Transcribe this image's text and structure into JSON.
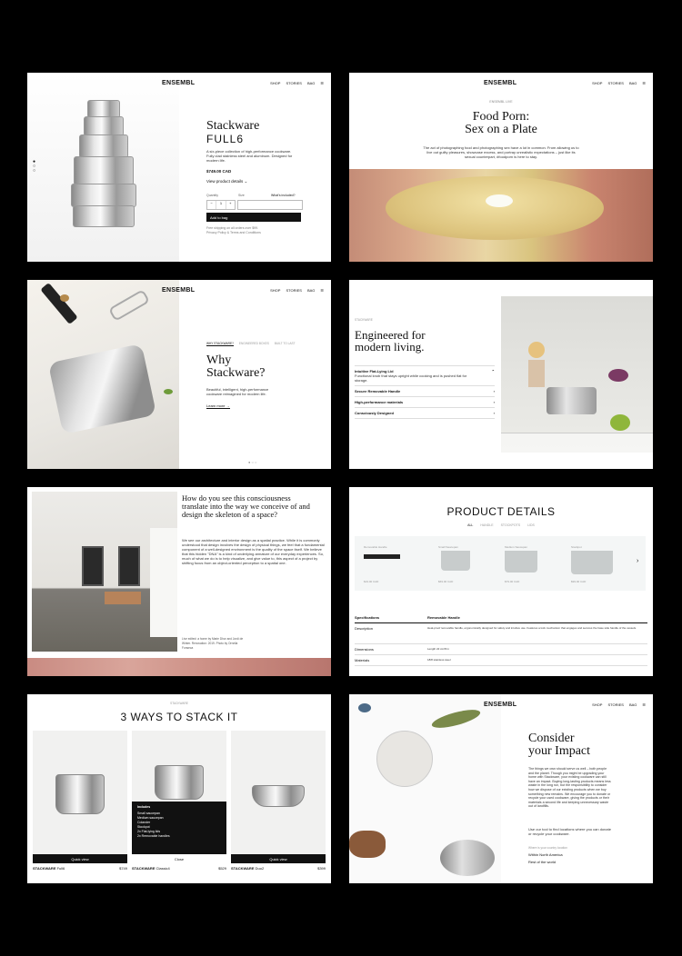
{
  "brand": "ENSEMBL",
  "nav": {
    "shop": "SHOP",
    "stories": "STORIES",
    "bag": "BAG",
    "menu": "☰"
  },
  "p1": {
    "title1": "Stackware",
    "title2": "FULL6",
    "desc": "A six-piece collection of high-performance cookware. Fully clad stainless steel and aluminum. Designed for modern life.",
    "price": "$749.00 CAD",
    "details": "View product details",
    "qty_label": "Quantity",
    "size_label": "Size",
    "size_hint": "What's included?",
    "add": "Add to bag",
    "note": "Free shipping on all orders over $99.\nPrivacy Policy & Terms and Conditions"
  },
  "p2": {
    "kicker": "ENSEMBL LIVE",
    "title1": "Food Porn:",
    "title2": "Sex on a Plate",
    "body": "The act of photographing food and photographing sex have a lot in common. From allowing us to live out guilty pleasures, showcase excess, and portray unrealistic expectations – just like its sexual counterpart, #foodporn is here to stay."
  },
  "p3": {
    "tabs": [
      "WHY STACKWARE?",
      "ENGINEERED BOXES",
      "BUILT TO LAST"
    ],
    "title1": "Why",
    "title2": "Stackware?",
    "body": "Beautiful, intelligent, high-performance cookware reimagined for modern life.",
    "learn": "Learn more"
  },
  "p4": {
    "kicker": "STACKWARE",
    "title1": "Engineered for",
    "title2": "modern living.",
    "items": [
      {
        "label": "Intuitive Flat-Lying Lid",
        "body": "Functional knob that stays upright while cooking and is pushed flat for storage."
      },
      {
        "label": "Secure Removable Handle",
        "body": ""
      },
      {
        "label": "High-performance materials",
        "body": ""
      },
      {
        "label": "Consciously Designed",
        "body": ""
      }
    ]
  },
  "p5": {
    "title": "How do you see this consciousness translate into the way we conceive of and design the skeleton of a space?",
    "body": "We see our architecture and interior design as a spatial practice. While it is commonly understood that design involves the design of physical things, we feel that a fundamental component of a well-designed environment is the quality of the space itself. We believe that this hidden \"DNA\" is a kind of underlying armature of our everyday experiences. So, much of what we do is to help visualize, and give value to, this aspect of a project by shifting focus from an object-oriented perception to a spatial one.",
    "caption": "Live edited: a home by Marie Dhor and Jordi de Winter. Renovation: 2019. Photo by Ornella Fonseca"
  },
  "p6": {
    "title": "PRODUCT DETAILS",
    "filters": [
      "ALL",
      "HANDLE",
      "STOCKPOTS",
      "LIDS"
    ],
    "items": [
      {
        "label": "Removable Handle",
        "meta": "$19.00 CAD"
      },
      {
        "label": "Small Saucepan",
        "meta": "$69.00 CAD"
      },
      {
        "label": "Medium Saucepan",
        "meta": "$79.00 CAD"
      },
      {
        "label": "Stockpot",
        "meta": "$99.00 CAD"
      }
    ],
    "spec_head": "Specifications",
    "spec_value": "Removable Handle",
    "specs": [
      {
        "k": "Description",
        "v": "Heat-proof removable handle, ergonomically designed for safety and intuitive use. Features a lock mechanism that engages and secures the base side handle of the vessels."
      },
      {
        "k": "Dimensions",
        "v": "Length 22 cm/8 in"
      },
      {
        "k": "Materials",
        "v": "18/8 stainless steel"
      }
    ]
  },
  "p7": {
    "kicker": "STACKWARE",
    "title": "3 WAYS TO STACK IT",
    "includes_title": "Includes",
    "includes": [
      "Small saucepan",
      "Medium saucepan",
      "Colander",
      "Stockpot",
      "2x Flat-lying lids",
      "2x Removable handles"
    ],
    "cards": [
      {
        "name": "STACKWARE",
        "model": "Full6",
        "price": "$749",
        "btn": "Quick view"
      },
      {
        "name": "STACKWARE",
        "model": "Classic4",
        "price": "$529",
        "btn": "Close"
      },
      {
        "name": "STACKWARE",
        "model": "Duo2",
        "price": "$399",
        "btn": "Quick view"
      }
    ]
  },
  "p8": {
    "title1": "Consider",
    "title2": "your Impact",
    "body": "The things we own should serve us well – both people and the planet. Though you might be upgrading your home with Stackware, your existing cookware can still have an impact. Buying long-lasting products means less waste in the long run, but the responsibility to consider how we dispose of our existing products when we buy something new remains. We encourage you to donate or recycle your used cookware, giving the products or their materials a second life and keeping unnecessary waste out of landfills.",
    "cta": "Use our tool to find locations where you can donate or recycle your cookware.",
    "select": "Where is your country location",
    "links": [
      "Within North America",
      "Rest of the world"
    ]
  }
}
